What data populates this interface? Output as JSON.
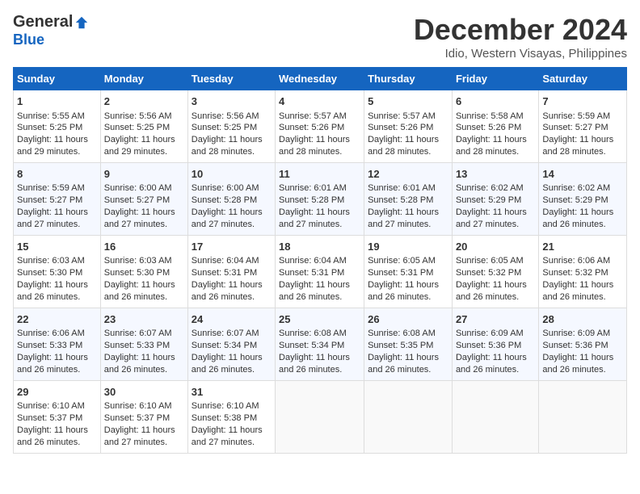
{
  "logo": {
    "general": "General",
    "blue": "Blue"
  },
  "title": {
    "month_year": "December 2024",
    "location": "Idio, Western Visayas, Philippines"
  },
  "headers": [
    "Sunday",
    "Monday",
    "Tuesday",
    "Wednesday",
    "Thursday",
    "Friday",
    "Saturday"
  ],
  "weeks": [
    [
      {
        "day": "1",
        "info": "Sunrise: 5:55 AM\nSunset: 5:25 PM\nDaylight: 11 hours\nand 29 minutes."
      },
      {
        "day": "2",
        "info": "Sunrise: 5:56 AM\nSunset: 5:25 PM\nDaylight: 11 hours\nand 29 minutes."
      },
      {
        "day": "3",
        "info": "Sunrise: 5:56 AM\nSunset: 5:25 PM\nDaylight: 11 hours\nand 28 minutes."
      },
      {
        "day": "4",
        "info": "Sunrise: 5:57 AM\nSunset: 5:26 PM\nDaylight: 11 hours\nand 28 minutes."
      },
      {
        "day": "5",
        "info": "Sunrise: 5:57 AM\nSunset: 5:26 PM\nDaylight: 11 hours\nand 28 minutes."
      },
      {
        "day": "6",
        "info": "Sunrise: 5:58 AM\nSunset: 5:26 PM\nDaylight: 11 hours\nand 28 minutes."
      },
      {
        "day": "7",
        "info": "Sunrise: 5:59 AM\nSunset: 5:27 PM\nDaylight: 11 hours\nand 28 minutes."
      }
    ],
    [
      {
        "day": "8",
        "info": "Sunrise: 5:59 AM\nSunset: 5:27 PM\nDaylight: 11 hours\nand 27 minutes."
      },
      {
        "day": "9",
        "info": "Sunrise: 6:00 AM\nSunset: 5:27 PM\nDaylight: 11 hours\nand 27 minutes."
      },
      {
        "day": "10",
        "info": "Sunrise: 6:00 AM\nSunset: 5:28 PM\nDaylight: 11 hours\nand 27 minutes."
      },
      {
        "day": "11",
        "info": "Sunrise: 6:01 AM\nSunset: 5:28 PM\nDaylight: 11 hours\nand 27 minutes."
      },
      {
        "day": "12",
        "info": "Sunrise: 6:01 AM\nSunset: 5:28 PM\nDaylight: 11 hours\nand 27 minutes."
      },
      {
        "day": "13",
        "info": "Sunrise: 6:02 AM\nSunset: 5:29 PM\nDaylight: 11 hours\nand 27 minutes."
      },
      {
        "day": "14",
        "info": "Sunrise: 6:02 AM\nSunset: 5:29 PM\nDaylight: 11 hours\nand 26 minutes."
      }
    ],
    [
      {
        "day": "15",
        "info": "Sunrise: 6:03 AM\nSunset: 5:30 PM\nDaylight: 11 hours\nand 26 minutes."
      },
      {
        "day": "16",
        "info": "Sunrise: 6:03 AM\nSunset: 5:30 PM\nDaylight: 11 hours\nand 26 minutes."
      },
      {
        "day": "17",
        "info": "Sunrise: 6:04 AM\nSunset: 5:31 PM\nDaylight: 11 hours\nand 26 minutes."
      },
      {
        "day": "18",
        "info": "Sunrise: 6:04 AM\nSunset: 5:31 PM\nDaylight: 11 hours\nand 26 minutes."
      },
      {
        "day": "19",
        "info": "Sunrise: 6:05 AM\nSunset: 5:31 PM\nDaylight: 11 hours\nand 26 minutes."
      },
      {
        "day": "20",
        "info": "Sunrise: 6:05 AM\nSunset: 5:32 PM\nDaylight: 11 hours\nand 26 minutes."
      },
      {
        "day": "21",
        "info": "Sunrise: 6:06 AM\nSunset: 5:32 PM\nDaylight: 11 hours\nand 26 minutes."
      }
    ],
    [
      {
        "day": "22",
        "info": "Sunrise: 6:06 AM\nSunset: 5:33 PM\nDaylight: 11 hours\nand 26 minutes."
      },
      {
        "day": "23",
        "info": "Sunrise: 6:07 AM\nSunset: 5:33 PM\nDaylight: 11 hours\nand 26 minutes."
      },
      {
        "day": "24",
        "info": "Sunrise: 6:07 AM\nSunset: 5:34 PM\nDaylight: 11 hours\nand 26 minutes."
      },
      {
        "day": "25",
        "info": "Sunrise: 6:08 AM\nSunset: 5:34 PM\nDaylight: 11 hours\nand 26 minutes."
      },
      {
        "day": "26",
        "info": "Sunrise: 6:08 AM\nSunset: 5:35 PM\nDaylight: 11 hours\nand 26 minutes."
      },
      {
        "day": "27",
        "info": "Sunrise: 6:09 AM\nSunset: 5:36 PM\nDaylight: 11 hours\nand 26 minutes."
      },
      {
        "day": "28",
        "info": "Sunrise: 6:09 AM\nSunset: 5:36 PM\nDaylight: 11 hours\nand 26 minutes."
      }
    ],
    [
      {
        "day": "29",
        "info": "Sunrise: 6:10 AM\nSunset: 5:37 PM\nDaylight: 11 hours\nand 26 minutes."
      },
      {
        "day": "30",
        "info": "Sunrise: 6:10 AM\nSunset: 5:37 PM\nDaylight: 11 hours\nand 27 minutes."
      },
      {
        "day": "31",
        "info": "Sunrise: 6:10 AM\nSunset: 5:38 PM\nDaylight: 11 hours\nand 27 minutes."
      },
      {
        "day": "",
        "info": ""
      },
      {
        "day": "",
        "info": ""
      },
      {
        "day": "",
        "info": ""
      },
      {
        "day": "",
        "info": ""
      }
    ]
  ]
}
